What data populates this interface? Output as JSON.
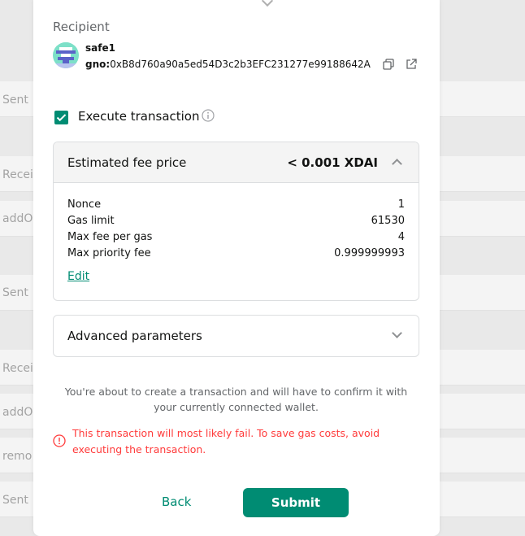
{
  "background": {
    "rows": [
      {
        "label": "Sent"
      },
      {
        "label": "Recei"
      },
      {
        "label": "addO"
      },
      {
        "label": "Sent"
      },
      {
        "label": "Recei"
      },
      {
        "label": "addO"
      },
      {
        "label": "remo"
      },
      {
        "label": "Sent"
      }
    ]
  },
  "recipient": {
    "label": "Recipient",
    "name": "safe1",
    "address_prefix": "gno:",
    "address": "0xB8d760a90a5ed54D3c2b3EFC231277e99188642A"
  },
  "execute": {
    "label": "Execute transaction",
    "checked": true
  },
  "fee": {
    "title": "Estimated fee price",
    "value": "< 0.001 XDAI",
    "rows": [
      {
        "key": "Nonce",
        "value": "1"
      },
      {
        "key": "Gas limit",
        "value": "61530"
      },
      {
        "key": "Max fee per gas",
        "value": "4"
      },
      {
        "key": "Max priority fee",
        "value": "0.999999993"
      }
    ],
    "edit_label": "Edit"
  },
  "advanced": {
    "title": "Advanced parameters"
  },
  "notice": "You're about to create a transaction and will have to confirm it with your currently connected wallet.",
  "warning": "This transaction will most likely fail. To save gas costs, avoid executing the transaction.",
  "actions": {
    "back_label": "Back",
    "submit_label": "Submit"
  },
  "colors": {
    "accent": "#008c73",
    "error": "#ff3b3b"
  }
}
